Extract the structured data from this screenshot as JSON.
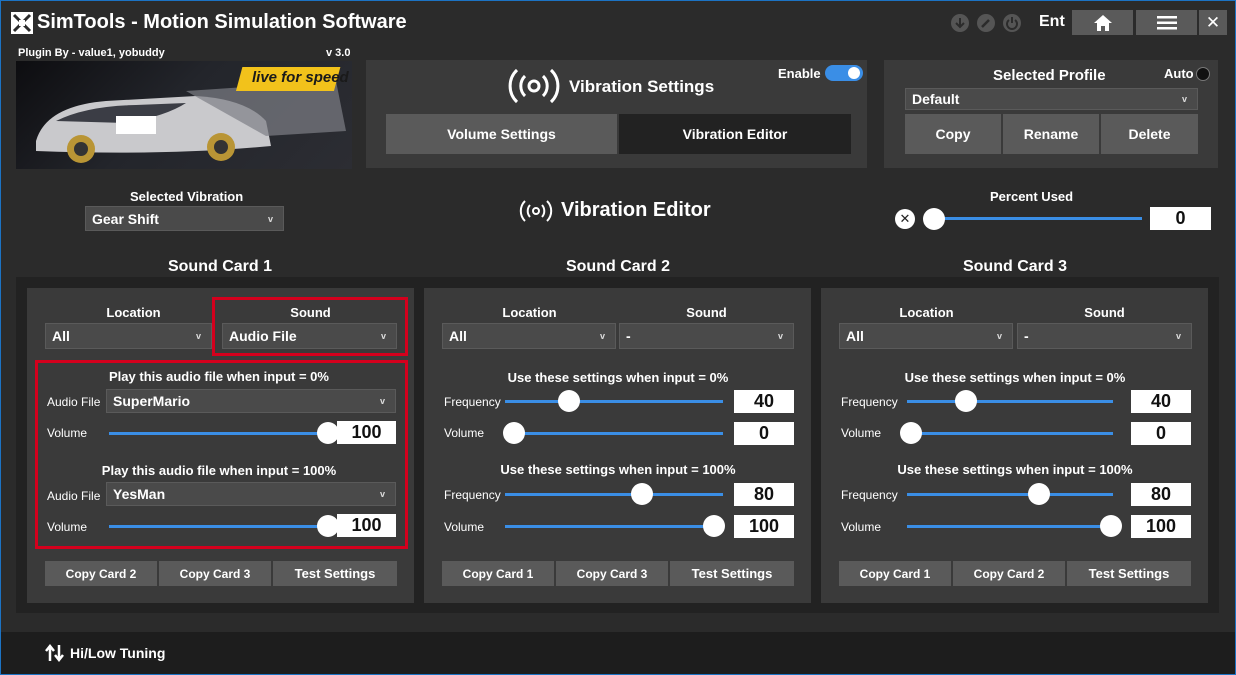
{
  "titlebar": {
    "app_title": "SimTools - Motion Simulation Software",
    "ent": "Ent",
    "icons": [
      "download-icon",
      "edit-icon",
      "power-icon"
    ],
    "home_icon": "home-icon",
    "menu_icon": "menu-icon",
    "close_label": "✕"
  },
  "plugin": {
    "by": "Plugin By - value1, yobuddy",
    "version": "v 3.0",
    "image_logo": "live for speed"
  },
  "vibration_settings": {
    "title": "Vibration Settings",
    "enable_label": "Enable",
    "enabled": true,
    "tabs": [
      "Volume Settings",
      "Vibration Editor"
    ],
    "active_tab": "Vibration Editor"
  },
  "profile": {
    "title": "Selected Profile",
    "auto_label": "Auto",
    "selected": "Default",
    "buttons": [
      "Copy",
      "Rename",
      "Delete"
    ]
  },
  "editor": {
    "selected_vibration_label": "Selected Vibration",
    "selected_vibration": "Gear Shift",
    "title": "Vibration Editor",
    "percent_used_label": "Percent Used",
    "percent_used": "0",
    "percent_slider": 0
  },
  "cards": [
    {
      "title": "Sound Card 1",
      "location_label": "Location",
      "sound_label": "Sound",
      "location": "All",
      "sound": "Audio File",
      "mode": "audio",
      "section0_title": "Play this audio file when input = 0%",
      "section100_title": "Play this audio file when input = 100%",
      "audio_file_label": "Audio File",
      "volume_label": "Volume",
      "file0": "SuperMario",
      "volume0": "100",
      "volume0_level": 1.0,
      "file100": "YesMan",
      "volume100": "100",
      "volume100_level": 1.0,
      "buttons": [
        "Copy Card 2",
        "Copy Card 3",
        "Test Settings"
      ]
    },
    {
      "title": "Sound Card 2",
      "location_label": "Location",
      "sound_label": "Sound",
      "location": "All",
      "sound": "-",
      "mode": "freq",
      "section0_title": "Use these settings when input = 0%",
      "section100_title": "Use these settings when input = 100%",
      "frequency_label": "Frequency",
      "volume_label": "Volume",
      "freq0": "40",
      "vol0": "0",
      "freq100": "80",
      "vol100": "100",
      "buttons": [
        "Copy Card 1",
        "Copy Card 3",
        "Test Settings"
      ]
    },
    {
      "title": "Sound Card 3",
      "location_label": "Location",
      "sound_label": "Sound",
      "location": "All",
      "sound": "-",
      "mode": "freq",
      "section0_title": "Use these settings when input = 0%",
      "section100_title": "Use these settings when input = 100%",
      "frequency_label": "Frequency",
      "volume_label": "Volume",
      "freq0": "40",
      "vol0": "0",
      "freq100": "80",
      "vol100": "100",
      "buttons": [
        "Copy Card 1",
        "Copy Card 2",
        "Test Settings"
      ]
    }
  ],
  "footer": {
    "label": "Hi/Low Tuning",
    "icon": "up-down-arrows-icon"
  },
  "colors": {
    "accent": "#3a8ee6",
    "highlight": "#d4001d",
    "window_border": "#1c73c4"
  }
}
